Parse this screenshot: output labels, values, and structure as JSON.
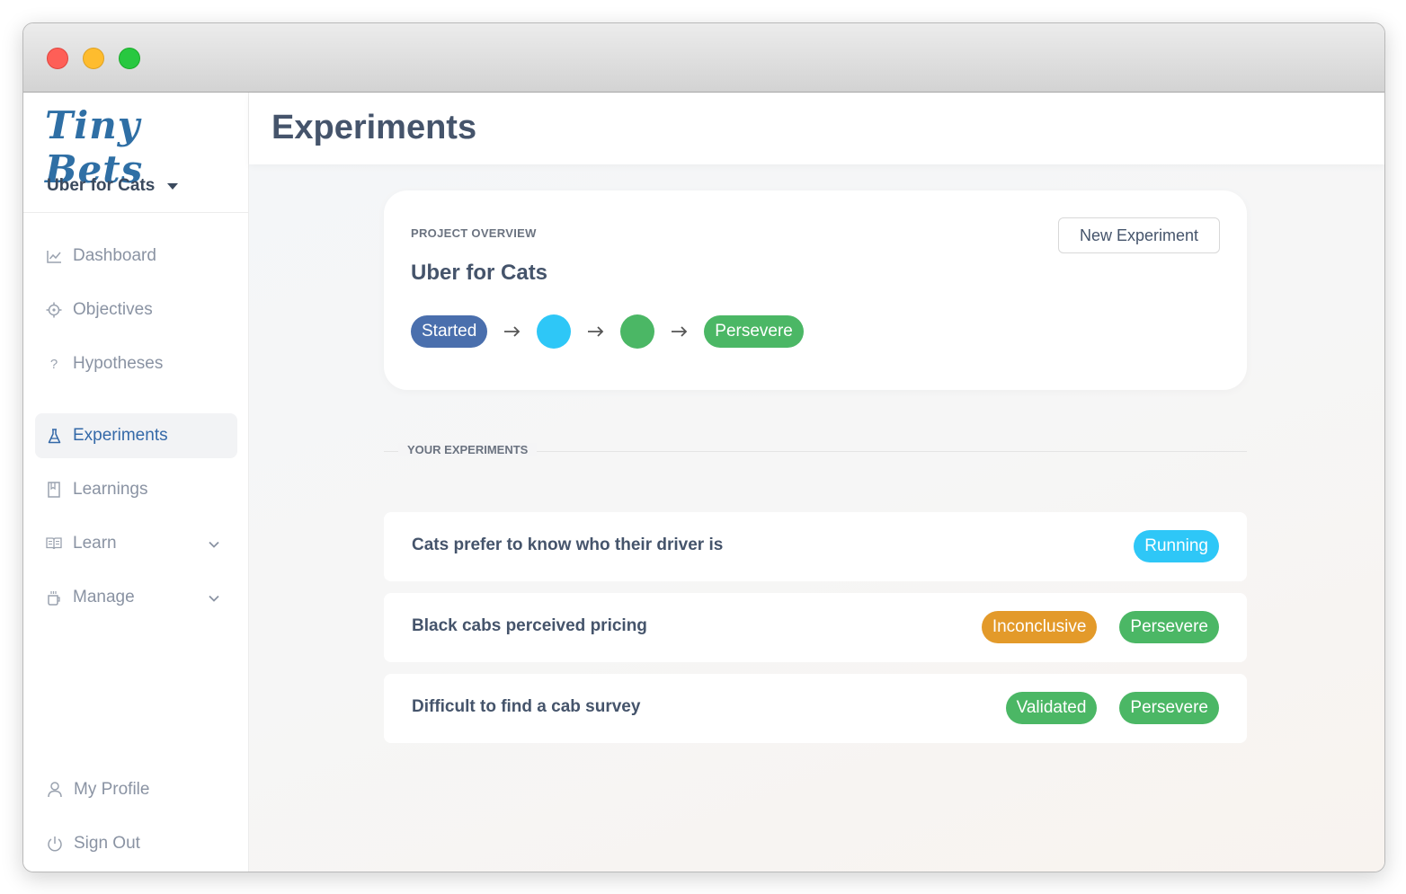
{
  "sidebar": {
    "logo": "Tiny Bets",
    "project": "Uber for Cats",
    "items": [
      {
        "label": "Dashboard",
        "icon": "chart-line-icon"
      },
      {
        "label": "Objectives",
        "icon": "crosshair-icon"
      },
      {
        "label": "Hypotheses",
        "icon": "question-icon"
      },
      {
        "label": "Experiments",
        "icon": "flask-icon",
        "active": true
      },
      {
        "label": "Learnings",
        "icon": "bookmark-icon"
      },
      {
        "label": "Learn",
        "icon": "book-open-icon",
        "expandable": true
      },
      {
        "label": "Manage",
        "icon": "mug-icon",
        "expandable": true
      }
    ],
    "bottom": [
      {
        "label": "My Profile",
        "icon": "user-icon"
      },
      {
        "label": "Sign Out",
        "icon": "power-icon"
      }
    ]
  },
  "header": {
    "title": "Experiments"
  },
  "overview": {
    "overline": "PROJECT OVERVIEW",
    "title": "Uber for Cats",
    "new_button": "New Experiment",
    "flow": {
      "start": "Started",
      "end": "Persevere",
      "step_colors": [
        "#2ec7f7",
        "#4bb765"
      ]
    }
  },
  "experiments_section": "YOUR EXPERIMENTS",
  "experiments": [
    {
      "title": "Cats prefer to know who their driver is",
      "badges": [
        {
          "label": "Running",
          "color": "#2ec7f7"
        }
      ]
    },
    {
      "title": "Black cabs perceived pricing",
      "badges": [
        {
          "label": "Inconclusive",
          "color": "#e39a2a"
        },
        {
          "label": "Persevere",
          "color": "#4bb765"
        }
      ]
    },
    {
      "title": "Difficult to find a cab survey",
      "badges": [
        {
          "label": "Validated",
          "color": "#4bb765"
        },
        {
          "label": "Persevere",
          "color": "#4bb765"
        }
      ]
    }
  ],
  "colors": {
    "accent": "#3469a8",
    "started": "#4a6fad",
    "running": "#2ec7f7",
    "inconclusive": "#e39a2a",
    "success": "#4bb765"
  }
}
